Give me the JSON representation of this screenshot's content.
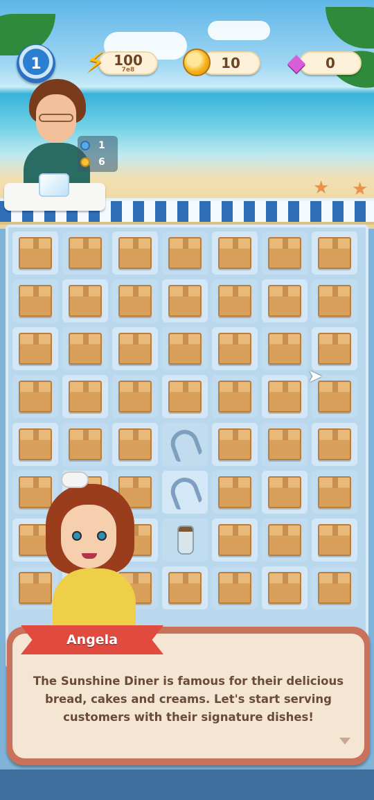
{
  "hud": {
    "level": "1",
    "energy": {
      "icon": "lightning-bolt-icon",
      "value": "100",
      "sublabel": "7e8"
    },
    "coins": {
      "icon": "gold-coin-icon",
      "value": "10"
    },
    "gems": {
      "icon": "pink-gem-icon",
      "value": "0"
    }
  },
  "customer_order": [
    {
      "icon": "blue-item-icon",
      "count": "1"
    },
    {
      "icon": "yellow-item-icon",
      "count": "6"
    }
  ],
  "board": {
    "columns": 7,
    "rows": 8,
    "tiles": [
      [
        "box",
        "box",
        "box",
        "box",
        "box",
        "box",
        "box"
      ],
      [
        "box",
        "box",
        "box",
        "box",
        "box",
        "box",
        "box"
      ],
      [
        "box",
        "box",
        "box",
        "box",
        "box",
        "box",
        "box"
      ],
      [
        "box",
        "box",
        "box",
        "box",
        "box",
        "box",
        "box"
      ],
      [
        "box",
        "box",
        "box",
        "horseshoe",
        "box",
        "box",
        "box"
      ],
      [
        "box",
        "box",
        "box",
        "horseshoe",
        "box",
        "box",
        "box"
      ],
      [
        "box",
        "box",
        "box",
        "bottle",
        "box",
        "box",
        "box"
      ],
      [
        "box",
        "box",
        "box",
        "box",
        "box",
        "box",
        "box"
      ]
    ]
  },
  "dialog": {
    "speaker": "Angela",
    "text": "The Sunshine Diner is famous for their delicious bread, cakes and creams. Let's start serving customers with their signature dishes!"
  },
  "colors": {
    "banner": "#e04a3f",
    "dialog_frame": "#c9715a",
    "dialog_bg": "#f5e6d3",
    "board_bg": "#b9d8ee"
  }
}
